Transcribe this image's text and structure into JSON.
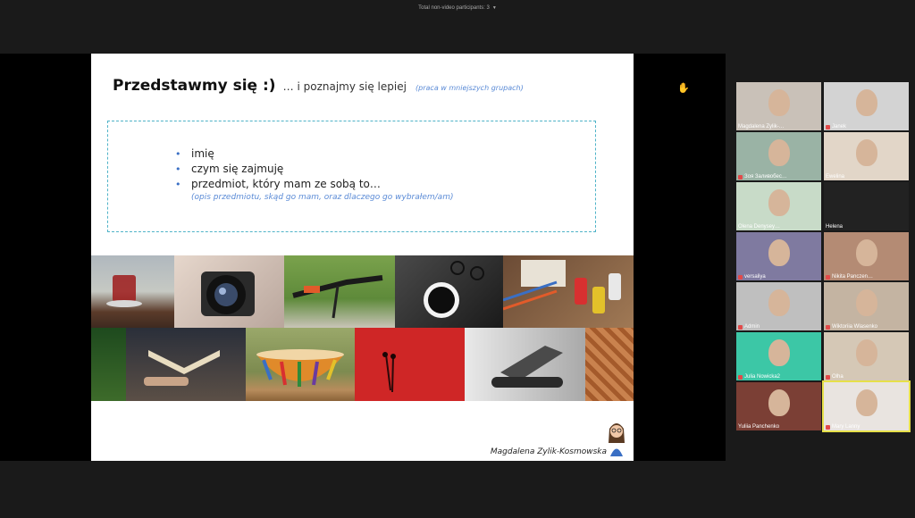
{
  "top": {
    "non_video": "Total non-video participants: 3"
  },
  "slide": {
    "title_bold": "Przedstawmy się :)",
    "title_rest": "… i poznajmy się lepiej",
    "title_note": "(praca w mniejszych grupach)",
    "bullets": [
      "imię",
      "czym się zajmuję",
      "przedmiot, który mam ze sobą to…"
    ],
    "sub": "(opis przedmiotu, skąd go mam, oraz dlaczego go wybrałem/am)",
    "author": "Magdalena Zylik-Kosmowska"
  },
  "participants": [
    {
      "name": "Magdalena Zylik-…",
      "bg": "#c9c1b8",
      "mic": false
    },
    {
      "name": "Janek",
      "bg": "#d3d3d3",
      "mic": true
    },
    {
      "name": "Зоя Заливобес…",
      "bg": "#9ab3a5",
      "mic": true
    },
    {
      "name": "Ewelina",
      "bg": "#e2d6c8",
      "mic": false
    },
    {
      "name": "Olena Denysey…",
      "bg": "#c8dbc8",
      "mic": false
    },
    {
      "name": "Helena",
      "bg": "#222222",
      "mic": false
    },
    {
      "name": "versaliya",
      "bg": "#7f7aa0",
      "mic": true
    },
    {
      "name": "Nikita Panczen…",
      "bg": "#b48b74",
      "mic": true
    },
    {
      "name": "Admin",
      "bg": "#bfbfbf",
      "mic": true
    },
    {
      "name": "Wiktoriia Wlasenko",
      "bg": "#c4b4a2",
      "mic": true
    },
    {
      "name": "Julia Nowicka2",
      "bg": "#3cc7a6",
      "mic": true
    },
    {
      "name": "Olha",
      "bg": "#d5c8b6",
      "mic": true
    },
    {
      "name": "Yuliia Panchenko",
      "bg": "#7b3f35",
      "mic": false
    },
    {
      "name": "Mary Lanny",
      "bg": "#e9e4e0",
      "mic": true
    }
  ]
}
